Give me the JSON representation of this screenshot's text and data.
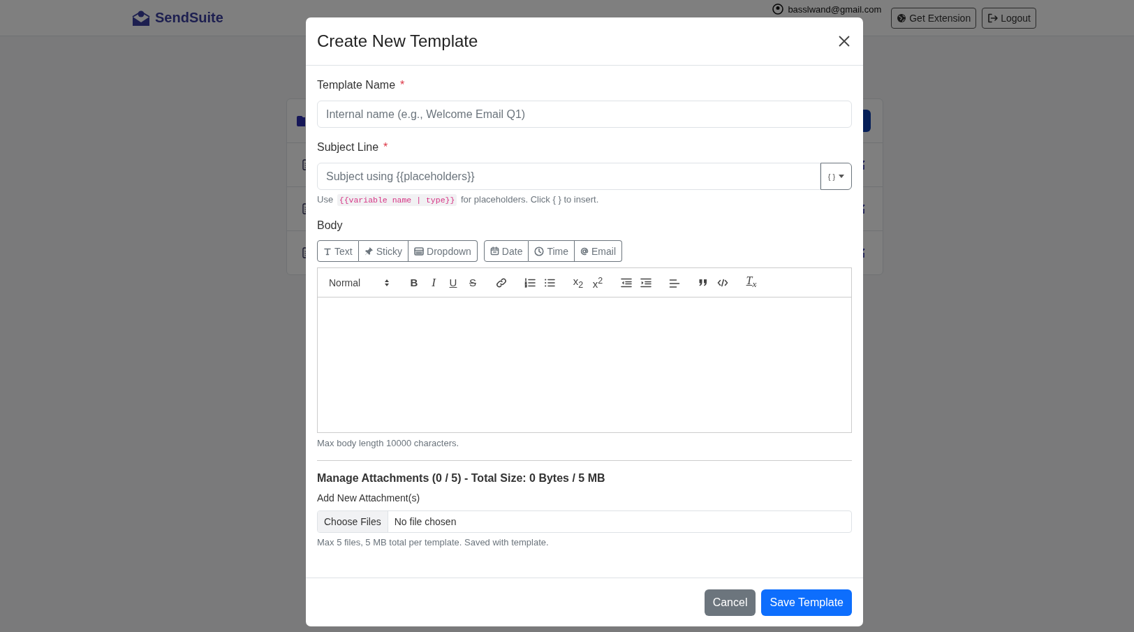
{
  "header": {
    "brand": "SendSuite",
    "user_email": "basslwand@gmail.com",
    "buttons": [
      {
        "label": "Get Extension",
        "kind": "extension"
      },
      {
        "label": "Logout",
        "kind": "logout"
      }
    ]
  },
  "modal": {
    "title": "Create New Template",
    "template_name": {
      "label": "Template Name",
      "required_mark": "*",
      "placeholder": "Internal name (e.g., Welcome Email Q1)"
    },
    "subject": {
      "label": "Subject Line",
      "required_mark": "*",
      "placeholder": "Subject using {{placeholders}}",
      "placeholder_button": "{ }",
      "help": {
        "before": "Use",
        "code": "{{variable name | type}}",
        "after": "for placeholders. Click { } to insert."
      }
    },
    "body": {
      "label": "Body",
      "insert_groups": [
        [
          {
            "label": "Text",
            "kind": "text"
          },
          {
            "label": "Sticky",
            "kind": "sticky"
          },
          {
            "label": "Dropdown",
            "kind": "dropdown"
          }
        ],
        [
          {
            "label": "Date",
            "kind": "date"
          },
          {
            "label": "Time",
            "kind": "time"
          },
          {
            "label": "Email",
            "kind": "email"
          }
        ]
      ],
      "format": "Normal",
      "toolbar": [
        {
          "kind": "bold",
          "glyph": "B"
        },
        {
          "kind": "italic",
          "glyph": "I"
        },
        {
          "kind": "underline",
          "glyph": "U"
        },
        {
          "kind": "strike",
          "glyph": "S"
        },
        {
          "kind": "link"
        },
        {
          "kind": "ordered-list"
        },
        {
          "kind": "bullet-list"
        },
        {
          "kind": "subscript",
          "glyph": "x$_{2}$"
        },
        {
          "kind": "superscript",
          "glyph": "x$^{2}$"
        },
        {
          "kind": "outdent"
        },
        {
          "kind": "indent"
        },
        {
          "kind": "align"
        },
        {
          "kind": "blockquote"
        },
        {
          "kind": "code-block"
        },
        {
          "kind": "clean",
          "glyph": "T$_{x}$"
        }
      ],
      "help": "Max body length 10000 characters."
    },
    "attachments": {
      "heading": "Manage Attachments (0 / 5) - Total Size: 0 Bytes / 5 MB",
      "label": "Add New Attachment(s)",
      "choose_button": "Choose Files",
      "file_status": "No file chosen",
      "help": "Max 5 files, 5 MB total per template. Saved with template."
    },
    "buttons": [
      {
        "label": "Cancel",
        "kind": "secondary"
      },
      {
        "label": "Save Template",
        "kind": "primary"
      }
    ]
  }
}
